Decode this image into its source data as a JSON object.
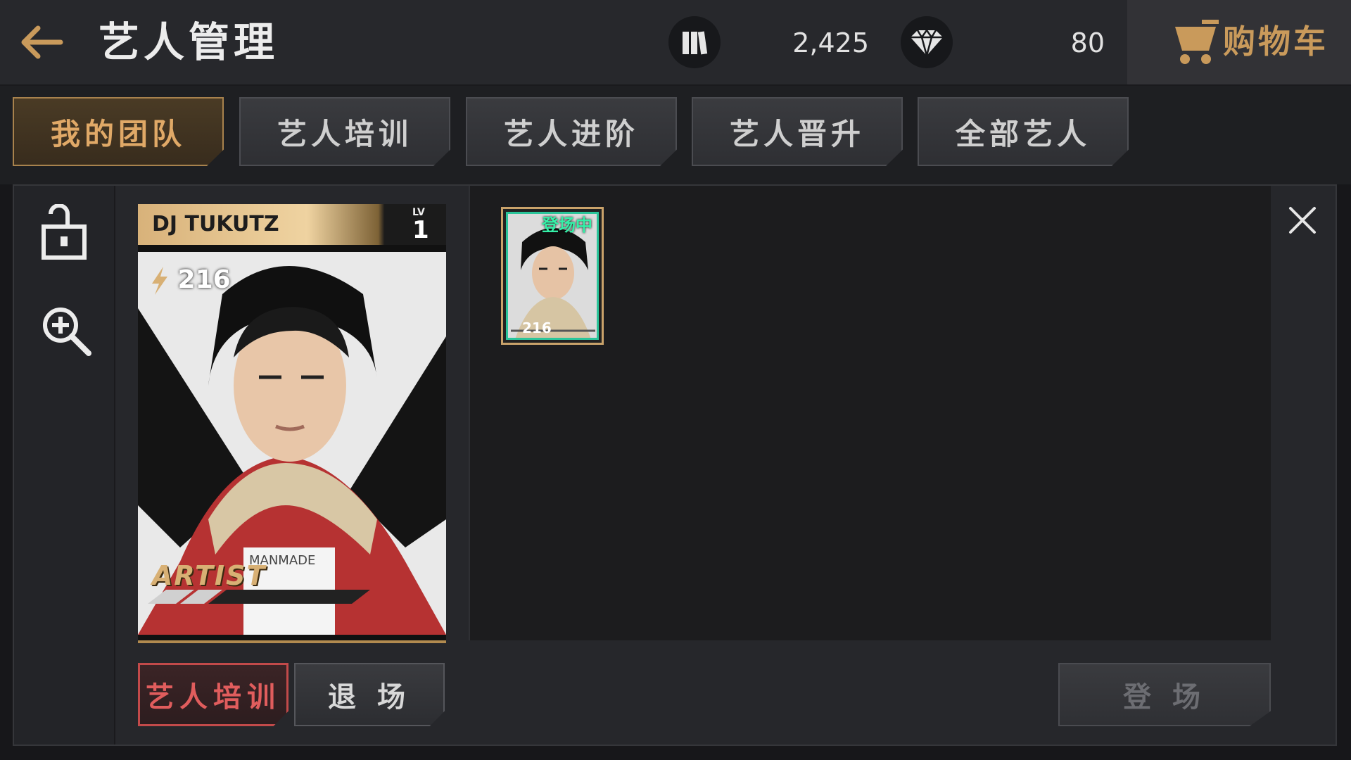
{
  "header": {
    "title": "艺人管理",
    "stat_1_value": "2,425",
    "stat_2_value": "80",
    "cart_label": "购物车"
  },
  "tabs": [
    {
      "label": "我的团队",
      "active": true
    },
    {
      "label": "艺人培训",
      "active": false
    },
    {
      "label": "艺人进阶",
      "active": false
    },
    {
      "label": "艺人晋升",
      "active": false
    },
    {
      "label": "全部艺人",
      "active": false
    }
  ],
  "card": {
    "name": "DJ TUKUTZ",
    "lv_label": "LV",
    "level": "1",
    "power": "216",
    "logo_text": "ARTIST",
    "shirt_text": "MANMADE"
  },
  "buttons": {
    "train": "艺人培训",
    "exit": "退 场",
    "debut": "登 场"
  },
  "roster": [
    {
      "status": "登场中",
      "power": "216"
    }
  ],
  "colors": {
    "accent_gold": "#c99a5b",
    "active_tab_text": "#e0a967",
    "train_red": "#e05d5d",
    "status_green": "#35f0a8"
  },
  "icons": [
    "back-arrow-icon",
    "cards-icon",
    "diamond-icon",
    "cart-icon",
    "unlock-icon",
    "zoom-in-icon",
    "close-icon",
    "lightning-icon"
  ]
}
